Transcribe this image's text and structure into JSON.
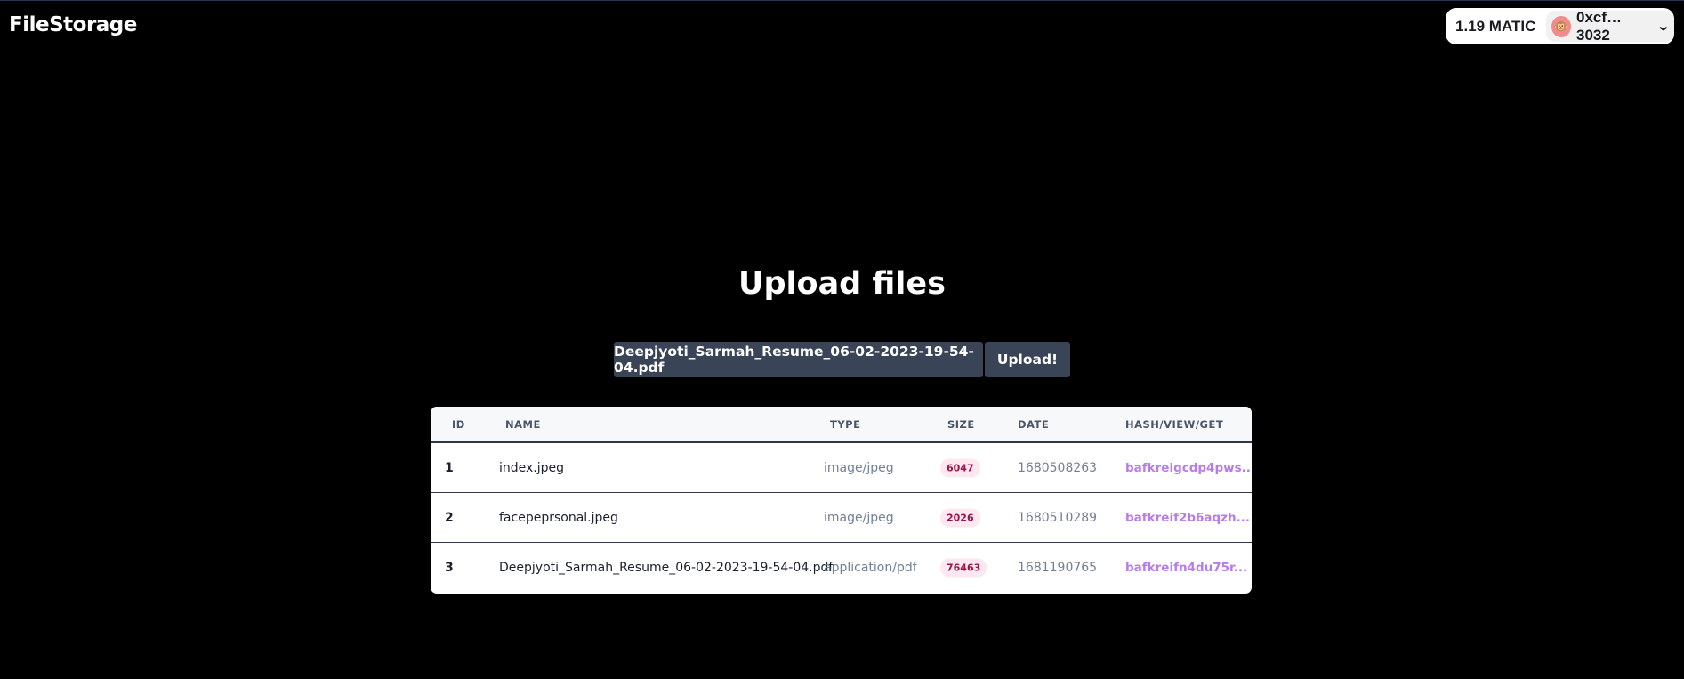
{
  "app": {
    "title": "FileStorage"
  },
  "wallet": {
    "balance": "1.19 MATIC",
    "account": "0xcf…3032",
    "avatar_icon": "emoji-avatar-icon"
  },
  "upload": {
    "heading": "Upload files",
    "selected_file": "Deepjyoti_Sarmah_Resume_06-02-2023-19-54-04.pdf",
    "upload_label": "Upload!"
  },
  "table": {
    "headers": [
      "ID",
      "NAME",
      "TYPE",
      "SIZE",
      "DATE",
      "HASH/VIEW/GET"
    ],
    "rows": [
      {
        "id": "1",
        "name": "index.jpeg",
        "type": "image/jpeg",
        "size": "6047",
        "date": "1680508263",
        "hash": "bafkreigcdp4pws..."
      },
      {
        "id": "2",
        "name": "facepeprsonal.jpeg",
        "type": "image/jpeg",
        "size": "2026",
        "date": "1680510289",
        "hash": "bafkreif2b6aqzh..."
      },
      {
        "id": "3",
        "name": "Deepjyoti_Sarmah_Resume_06-02-2023-19-54-04.pdf",
        "type": "application/pdf",
        "size": "76463",
        "date": "1681190765",
        "hash": "bafkreifn4du75r..."
      }
    ]
  },
  "colors": {
    "button_bg": "#3a4457",
    "hash_link": "#b77ce8",
    "size_badge_bg": "#fde7f0",
    "size_badge_text": "#97174a"
  }
}
